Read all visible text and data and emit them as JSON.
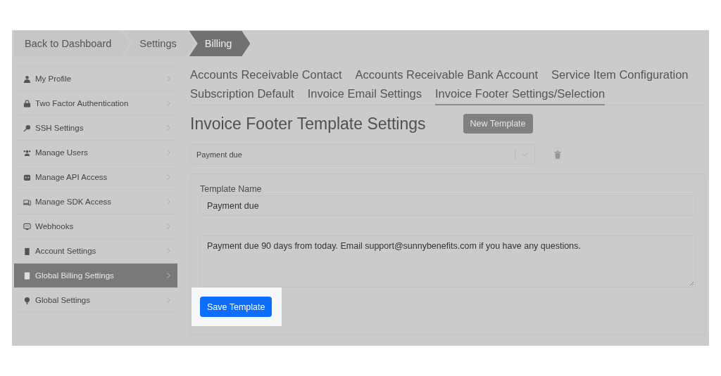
{
  "breadcrumbs": [
    {
      "label": "Back to Dashboard",
      "selected": false
    },
    {
      "label": "Settings",
      "selected": false
    },
    {
      "label": "Billing",
      "selected": true
    }
  ],
  "sidebar": {
    "items": [
      {
        "label": "My Profile",
        "selected": false
      },
      {
        "label": "Two Factor Authentication",
        "selected": false
      },
      {
        "label": "SSH Settings",
        "selected": false
      },
      {
        "label": "Manage Users",
        "selected": false
      },
      {
        "label": "Manage API Access",
        "selected": false
      },
      {
        "label": "Manage SDK Access",
        "selected": false
      },
      {
        "label": "Webhooks",
        "selected": false
      },
      {
        "label": "Account Settings",
        "selected": false
      },
      {
        "label": "Global Billing Settings",
        "selected": true
      },
      {
        "label": "Global Settings",
        "selected": false
      }
    ]
  },
  "tabs": [
    {
      "label": "Accounts Receivable Contact",
      "selected": false
    },
    {
      "label": "Accounts Receivable Bank Account",
      "selected": false
    },
    {
      "label": "Service Item Configuration",
      "selected": false
    },
    {
      "label": "Subscription Default",
      "selected": false
    },
    {
      "label": "Invoice Email Settings",
      "selected": false
    },
    {
      "label": "Invoice Footer Settings/Selection",
      "selected": true
    }
  ],
  "heading": "Invoice Footer Template Settings",
  "new_button": "New Template",
  "template_select": {
    "value": "Payment due"
  },
  "form": {
    "name_label": "Template Name",
    "name_value": "Payment due",
    "footer_text": "Payment due 90 days from today. Email support@sunnybenefits.com if you have any questions.",
    "save_button": "Save Template"
  }
}
